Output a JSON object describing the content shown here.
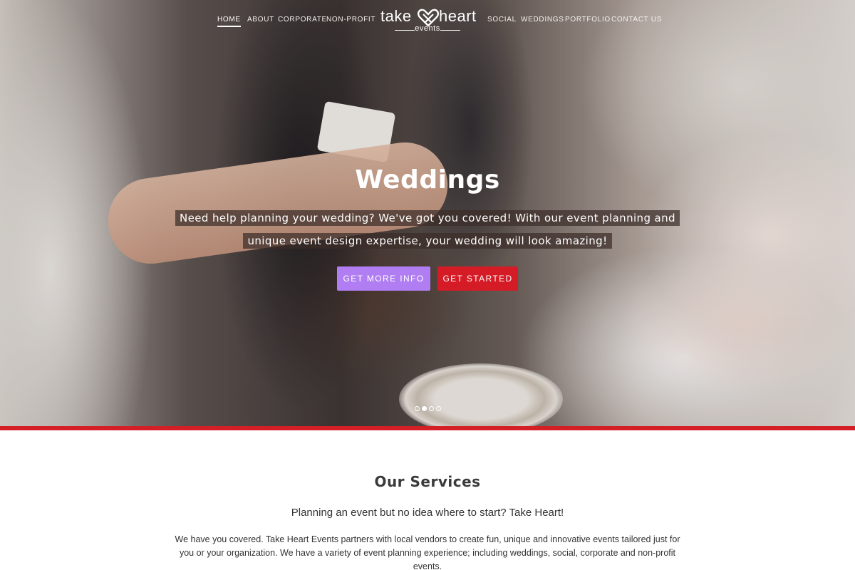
{
  "nav": {
    "left": [
      "HOME",
      "ABOUT",
      "CORPORATE",
      "NON-PROFIT"
    ],
    "right": [
      "SOCIAL",
      "WEDDINGS",
      "PORTFOLIO",
      "CONTACT US"
    ],
    "active": "HOME"
  },
  "logo": {
    "take": "take",
    "heart": "heart",
    "events": "events",
    "icon": "heart-logo-icon"
  },
  "hero": {
    "title": "Weddings",
    "subtitle_line1": "Need help planning your wedding? We've got you covered! With our event planning and",
    "subtitle_line2": "unique event design expertise, your wedding will look amazing!",
    "buttons": {
      "info": "GET MORE INFO",
      "start": "GET STARTED"
    },
    "slides_total": 4,
    "slide_active": 2
  },
  "services": {
    "title": "Our Services",
    "lead": "Planning an event but no idea where to start? Take Heart!",
    "body": "We have you covered. Take Heart Events partners with local vendors to create fun, unique and innovative events tailored just for you or your organization. We have a variety of event planning experience; including weddings, social, corporate and non-profit events."
  },
  "colors": {
    "accent_red": "#d31f25",
    "button_purple": "#b07ef2",
    "button_red": "#d51b26"
  }
}
